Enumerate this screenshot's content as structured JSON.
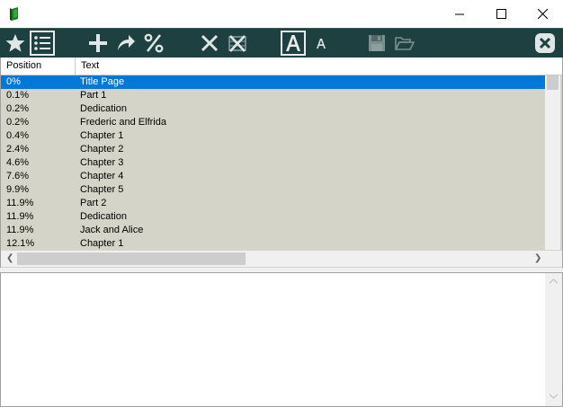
{
  "window": {
    "app_icon": "green-book-icon",
    "controls": [
      "minimize-icon",
      "maximize-icon",
      "close-icon"
    ]
  },
  "toolbar": {
    "buttons": [
      "star-icon",
      "list-icon",
      "plus-icon",
      "redo-arrow-icon",
      "percent-icon",
      "x-icon",
      "clear-all-icon",
      "font-large-icon",
      "font-small-icon",
      "save-icon",
      "open-folder-icon",
      "close-circle-icon"
    ]
  },
  "bookmarks": {
    "columns": {
      "position": "Position",
      "text": "Text"
    },
    "rows": [
      {
        "position": "0%",
        "text": "Title Page",
        "selected": true
      },
      {
        "position": "0.1%",
        "text": "Part 1"
      },
      {
        "position": "0.2%",
        "text": "Dedication"
      },
      {
        "position": "0.2%",
        "text": "Frederic and Elfrida"
      },
      {
        "position": "0.4%",
        "text": "Chapter 1"
      },
      {
        "position": "2.4%",
        "text": "Chapter 2"
      },
      {
        "position": "4.6%",
        "text": "Chapter 3"
      },
      {
        "position": "7.6%",
        "text": "Chapter 4"
      },
      {
        "position": "9.9%",
        "text": "Chapter 5"
      },
      {
        "position": "11.9%",
        "text": "Part 2"
      },
      {
        "position": "11.9%",
        "text": "Dedication"
      },
      {
        "position": "11.9%",
        "text": "Jack and Alice"
      },
      {
        "position": "12.1%",
        "text": "Chapter 1"
      }
    ]
  },
  "text_pane": {
    "content": ""
  },
  "colors": {
    "toolbar_bg": "#1f4040",
    "list_bg": "#d4d4c8",
    "selection": "#0078d7"
  }
}
